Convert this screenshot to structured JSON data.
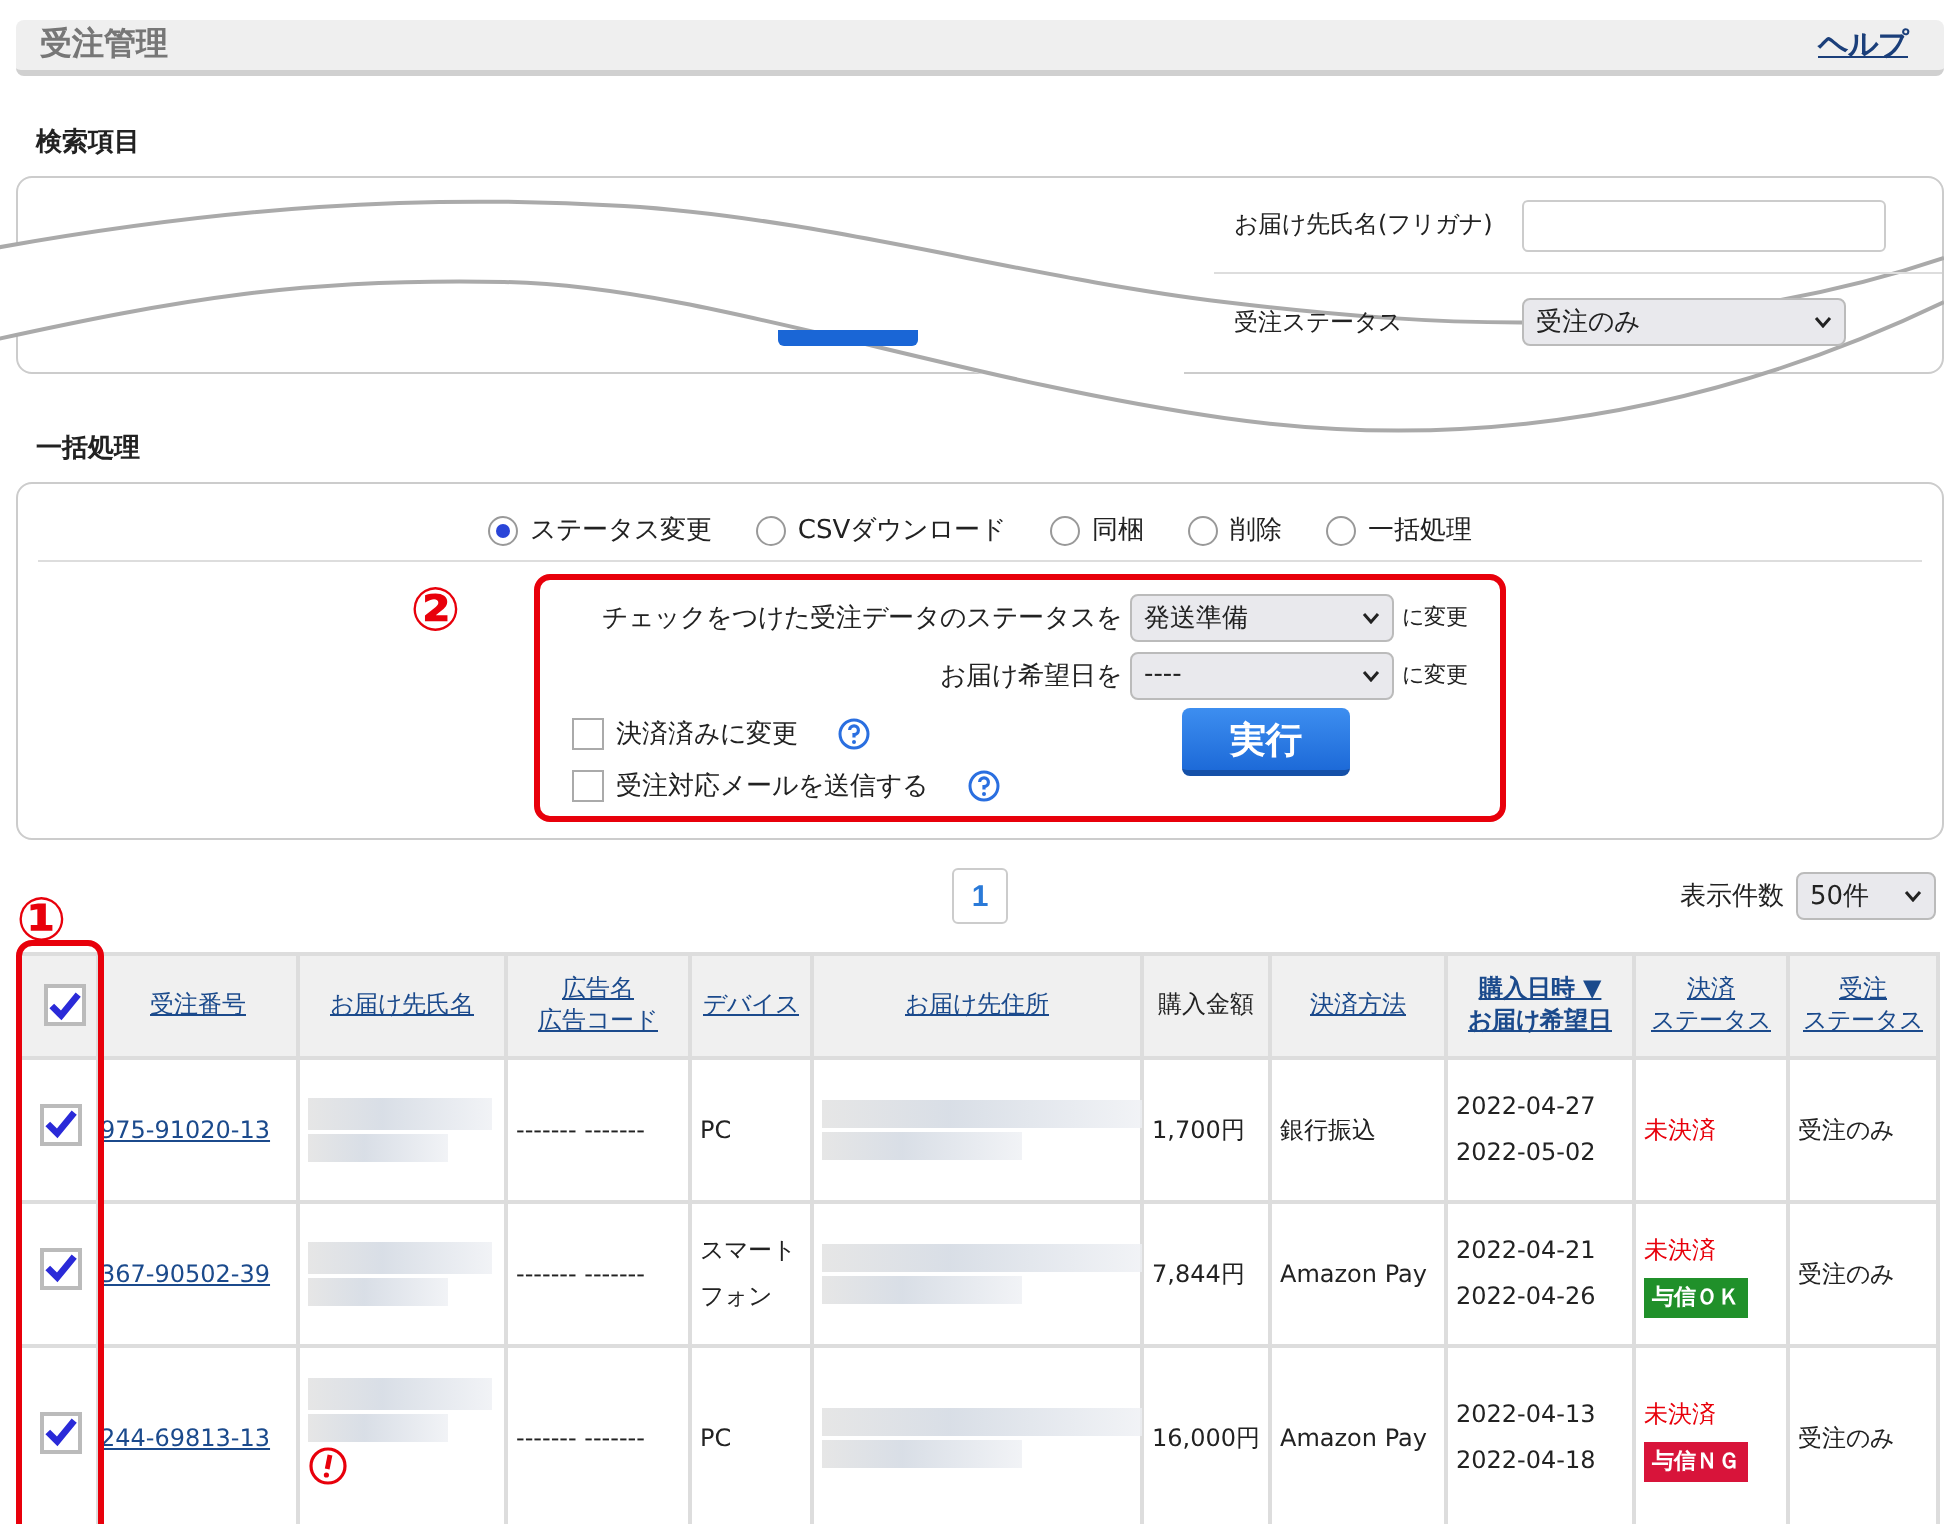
{
  "header": {
    "title": "受注管理",
    "help": "ヘルプ"
  },
  "search": {
    "heading": "検索項目",
    "fields": [
      {
        "label": "お届け先氏名(フリガナ)",
        "kind": "input"
      },
      {
        "label": "受注ステータス",
        "kind": "select",
        "value": "受注のみ"
      }
    ]
  },
  "batch": {
    "heading": "一括処理",
    "modes": [
      {
        "label": "ステータス変更",
        "selected": true
      },
      {
        "label": "CSVダウンロード",
        "selected": false
      },
      {
        "label": "同梱",
        "selected": false
      },
      {
        "label": "削除",
        "selected": false
      },
      {
        "label": "一括処理",
        "selected": false
      }
    ],
    "status_label": "チェックをつけた受注データのステータスを",
    "status_value": "発送準備",
    "status_suffix": "に変更",
    "date_label": "お届け希望日を",
    "date_value": "----",
    "date_suffix": "に変更",
    "options": [
      {
        "label": "決済済みに変更",
        "checked": false
      },
      {
        "label": "受注対応メールを送信する",
        "checked": false
      }
    ],
    "execute": "実行",
    "annotation": "②"
  },
  "pagination": {
    "pages": [
      {
        "label": "1",
        "selected": true
      }
    ],
    "per_page_label": "表示件数",
    "per_page_value": "50件"
  },
  "table": {
    "annotation": "①",
    "select_all": true,
    "columns": [
      {
        "lines": [
          "受注番号"
        ],
        "link": true,
        "sorted": false
      },
      {
        "lines": [
          "お届け先氏名"
        ],
        "link": true,
        "sorted": false
      },
      {
        "lines": [
          "広告名",
          "広告コード"
        ],
        "link": true,
        "sorted": false
      },
      {
        "lines": [
          "デバイス"
        ],
        "link": true,
        "sorted": false
      },
      {
        "lines": [
          "お届け先住所"
        ],
        "link": true,
        "sorted": false
      },
      {
        "lines": [
          "購入金額"
        ],
        "link": false,
        "sorted": false
      },
      {
        "lines": [
          "決済方法"
        ],
        "link": true,
        "sorted": false
      },
      {
        "lines": [
          "購入日時 ▼",
          "お届け希望日"
        ],
        "link": true,
        "sorted": true
      },
      {
        "lines": [
          "決済",
          "ステータス"
        ],
        "link": true,
        "sorted": false
      },
      {
        "lines": [
          "受注",
          "ステータス"
        ],
        "link": true,
        "sorted": false
      }
    ],
    "rows": [
      {
        "checked": true,
        "order_no": "975-91020-13",
        "warning": false,
        "ad": "------- -------",
        "device": "PC",
        "amount": "1,700円",
        "payment": "銀行振込",
        "dates": [
          "2022-04-27",
          "2022-05-02"
        ],
        "payment_status": "未決済",
        "credit": null,
        "order_status": "受注のみ"
      },
      {
        "checked": true,
        "order_no": "367-90502-39",
        "warning": false,
        "ad": "------- -------",
        "device": "スマートフォン",
        "amount": "7,844円",
        "payment": "Amazon Pay",
        "dates": [
          "2022-04-21",
          "2022-04-26"
        ],
        "payment_status": "未決済",
        "credit": {
          "label": "与信ＯＫ",
          "kind": "ok"
        },
        "order_status": "受注のみ"
      },
      {
        "checked": true,
        "order_no": "244-69813-13",
        "warning": true,
        "ad": "------- -------",
        "device": "PC",
        "amount": "16,000円",
        "payment": "Amazon Pay",
        "dates": [
          "2022-04-13",
          "2022-04-18"
        ],
        "payment_status": "未決済",
        "credit": {
          "label": "与信ＮＧ",
          "kind": "ng"
        },
        "order_status": "受注のみ"
      }
    ]
  }
}
